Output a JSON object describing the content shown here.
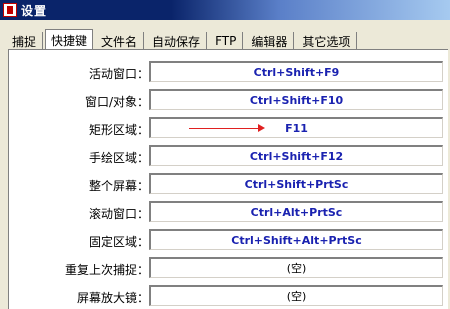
{
  "window": {
    "title": "设置"
  },
  "tabs": [
    {
      "label": "捕捉"
    },
    {
      "label": "快捷键",
      "active": true
    },
    {
      "label": "文件名"
    },
    {
      "label": "自动保存"
    },
    {
      "label": "FTP"
    },
    {
      "label": "编辑器"
    },
    {
      "label": "其它选项"
    }
  ],
  "shortcuts": [
    {
      "label": "活动窗口：",
      "value": "Ctrl+Shift+F9"
    },
    {
      "label": "窗口/对象：",
      "value": "Ctrl+Shift+F10"
    },
    {
      "label": "矩形区域：",
      "value": "F11"
    },
    {
      "label": "手绘区域：",
      "value": "Ctrl+Shift+F12"
    },
    {
      "label": "整个屏幕：",
      "value": "Ctrl+Shift+PrtSc"
    },
    {
      "label": "滚动窗口：",
      "value": "Ctrl+Alt+PrtSc"
    },
    {
      "label": "固定区域：",
      "value": "Ctrl+Shift+Alt+PrtSc"
    },
    {
      "label": "重复上次捕捉：",
      "value": "(空)"
    },
    {
      "label": "屏幕放大镜：",
      "value": "(空)"
    }
  ],
  "colors": {
    "accent": "#1a22b0",
    "arrow": "#e02020",
    "titlebar": "#0a246a"
  }
}
